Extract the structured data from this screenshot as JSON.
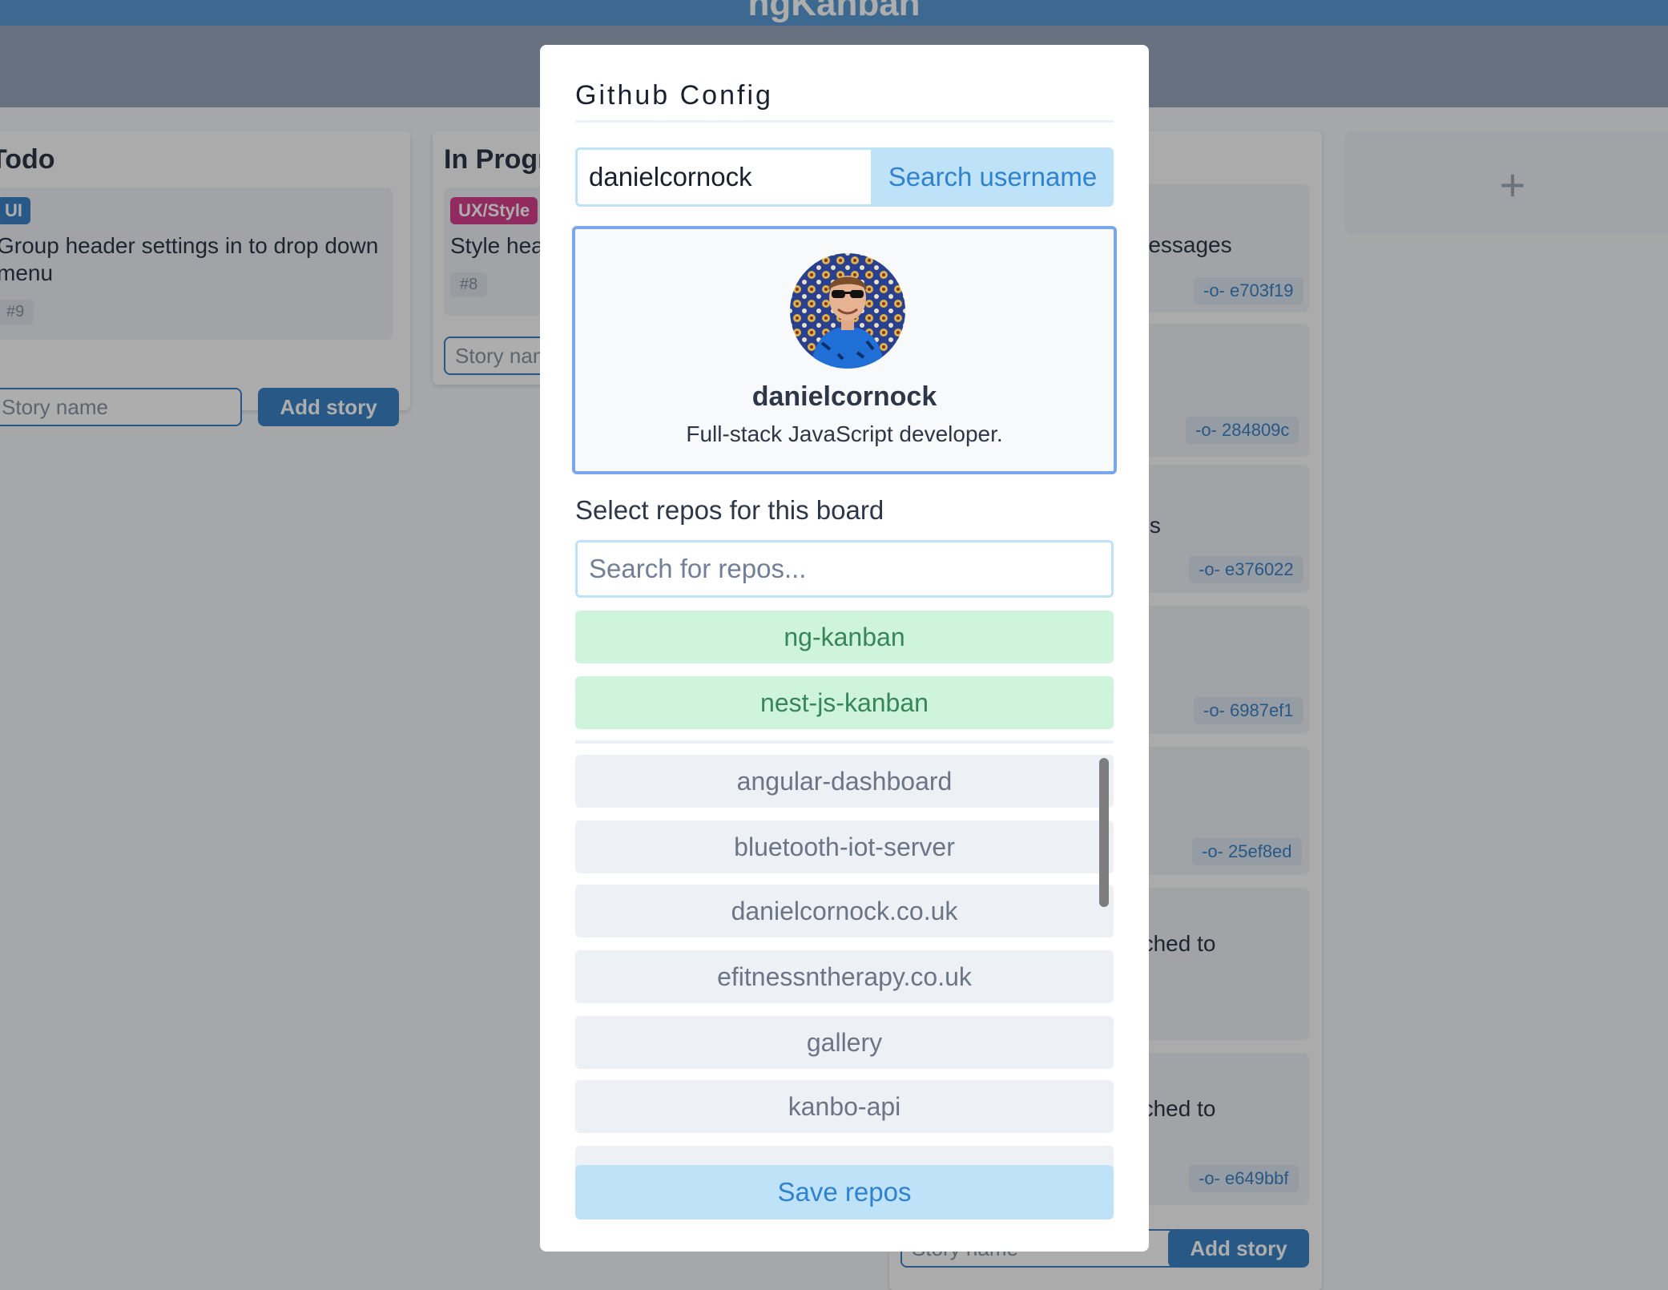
{
  "app": {
    "title": "ngKanban"
  },
  "columns": {
    "todo": {
      "title": "Todo",
      "card": {
        "tag": "UI",
        "text": "Group header settings in to drop down menu",
        "issue": "#9"
      },
      "story_placeholder": "Story name",
      "add_label": "Add story"
    },
    "in_progress": {
      "title": "In Progress",
      "card": {
        "tag": "UX/Style",
        "text": "Style header",
        "issue": "#8"
      },
      "story_placeholder": "Story name"
    },
    "third": {
      "fragments": [
        "messages",
        "rds",
        "ached to",
        "ached to"
      ],
      "commits": [
        "e703f19",
        "284809c",
        "e376022",
        "6987ef1",
        "25ef8ed",
        "e649bbf"
      ],
      "story_placeholder": "Story name",
      "add_label": "Add story"
    },
    "add_column_icon": "plus-icon"
  },
  "modal": {
    "title": "Github Config",
    "username_value": "danielcornock",
    "search_button": "Search username",
    "profile": {
      "username": "danielcornock",
      "bio": "Full-stack JavaScript developer."
    },
    "repos_label": "Select repos for this board",
    "repo_search_placeholder": "Search for repos...",
    "selected_repos": [
      "ng-kanban",
      "nest-js-kanban"
    ],
    "available_repos": [
      "angular-dashboard",
      "bluetooth-iot-server",
      "danielcornock.co.uk",
      "efitnessntherapy.co.uk",
      "gallery",
      "kanbo-api",
      ""
    ],
    "save_button": "Save repos"
  },
  "colors": {
    "header": "#5b9bd5",
    "primary": "#3b82c4",
    "selected_bg": "#cff4dc",
    "selected_text": "#38855a",
    "button_bg": "#bee3f8",
    "button_text": "#3182ce",
    "tag_ui": "#3b82c4",
    "tag_ux": "#d53f8c"
  }
}
